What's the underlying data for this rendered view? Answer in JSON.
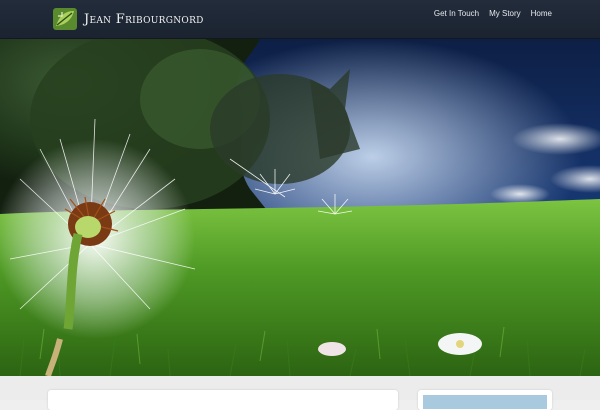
{
  "site": {
    "name": "Jean Fribourgnord",
    "logo_icon": "leaf-logo-icon"
  },
  "nav": {
    "items": [
      {
        "label": "Get In Touch"
      },
      {
        "label": "My Story"
      },
      {
        "label": "Home"
      }
    ]
  },
  "hero": {
    "image": "dandelion-in-grass-field",
    "colors": {
      "sky": "#0f2650",
      "grass": "#5aa52c",
      "trees": "#2c4a24"
    }
  },
  "colors": {
    "header_bg": "#1f2937",
    "page_bg": "#ececec",
    "nav_text": "#e6e9ee"
  }
}
